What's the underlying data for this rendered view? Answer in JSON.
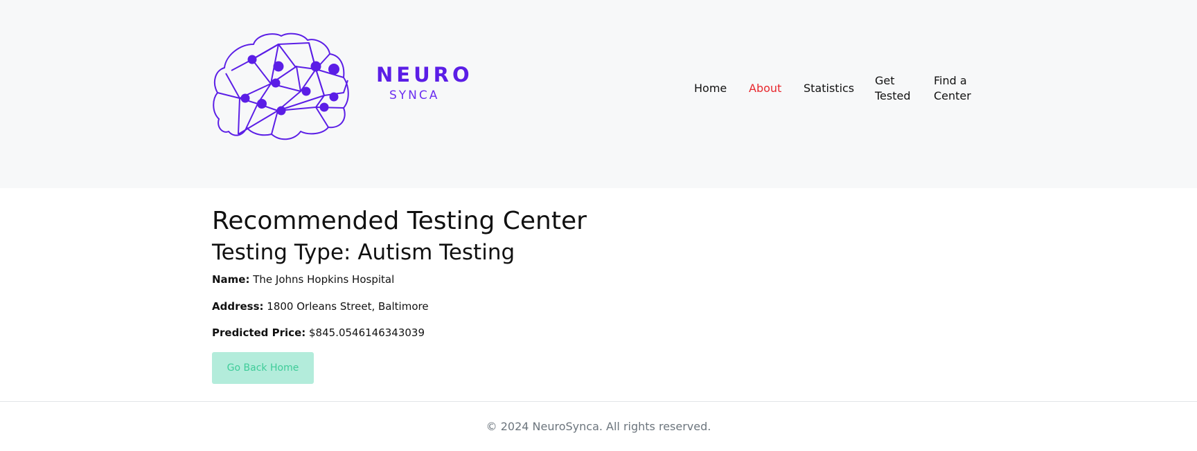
{
  "brand": {
    "name_top": "NEURO",
    "name_bottom": "SYNCA",
    "color": "#5b1ee6",
    "logo_icon": "brain-network-icon"
  },
  "nav": {
    "items": [
      {
        "label": "Home",
        "active": false
      },
      {
        "label": "About",
        "active": true
      },
      {
        "label": "Statistics",
        "active": false
      },
      {
        "label": "Get Tested",
        "active": false
      },
      {
        "label": "Find a Center",
        "active": false
      }
    ],
    "active_color": "#e8272d"
  },
  "main": {
    "title": "Recommended Testing Center",
    "subtitle": "Testing Type: Autism Testing",
    "fields": [
      {
        "label": "Name:",
        "value": "The Johns Hopkins Hospital"
      },
      {
        "label": "Address:",
        "value": "1800 Orleans Street, Baltimore"
      },
      {
        "label": "Predicted Price:",
        "value": "$845.0546146343039"
      }
    ],
    "back_button_label": "Go Back Home"
  },
  "footer": {
    "text": "© 2024 NeuroSynca. All rights reserved."
  }
}
